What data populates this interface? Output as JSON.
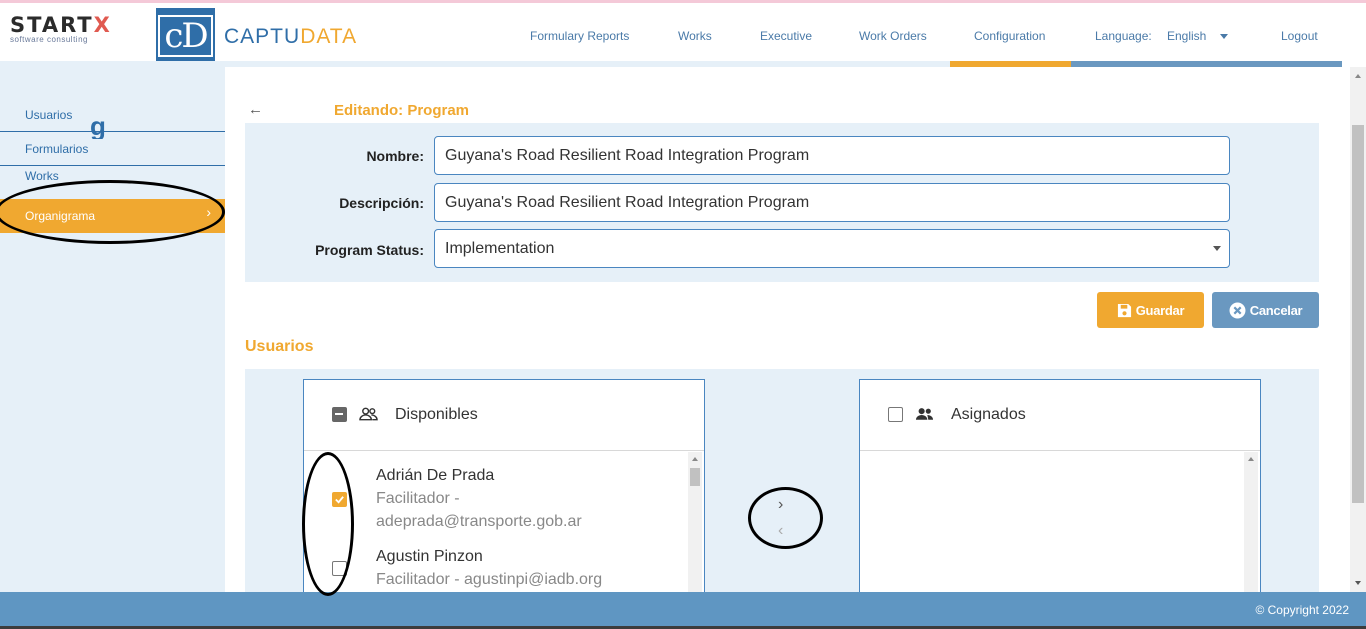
{
  "brand": {
    "startx_main": "START",
    "startx_x": "X",
    "startx_tagline": "software consulting",
    "cd_logo": "cD",
    "name_part1": "CAPTU",
    "name_part2": "DATA"
  },
  "nav": {
    "items": [
      {
        "label": "Formulary Reports"
      },
      {
        "label": "Works"
      },
      {
        "label": "Executive"
      },
      {
        "label": "Work Orders"
      },
      {
        "label": "Configuration"
      }
    ],
    "language_label": "Language:",
    "language_value": "English",
    "logout": "Logout"
  },
  "sidebar": {
    "items": [
      {
        "label": "Usuarios"
      },
      {
        "label": "Formularios"
      },
      {
        "label": "Works"
      },
      {
        "label": "Organigrama"
      }
    ]
  },
  "edit": {
    "title": "Editando: Program"
  },
  "form": {
    "name_label": "Nombre:",
    "name_value": "Guyana's Road Resilient Road Integration Program",
    "description_label": "Descripción:",
    "description_value": "Guyana's Road Resilient Road Integration Program",
    "status_label": "Program Status:",
    "status_value": "Implementation"
  },
  "buttons": {
    "save": "Guardar",
    "cancel": "Cancelar"
  },
  "users": {
    "section_title": "Usuarios",
    "available_title": "Disponibles",
    "assigned_title": "Asignados",
    "available": [
      {
        "name": "Adrián De Prada",
        "meta_line1": "Facilitador -",
        "meta_line2": "adeprada@transporte.gob.ar",
        "checked": true
      },
      {
        "name": "Agustin Pinzon",
        "meta_line1": "Facilitador - agustinpi@iadb.org",
        "checked": false
      }
    ],
    "move_right": "›",
    "move_left": "‹"
  },
  "footer": {
    "copyright": "© Copyright 2022"
  },
  "colors": {
    "accent_orange": "#f0a830",
    "primary_blue": "#2f6ea8",
    "panel_bg": "#e6f0f8",
    "footer_blue": "#5f96c2"
  }
}
